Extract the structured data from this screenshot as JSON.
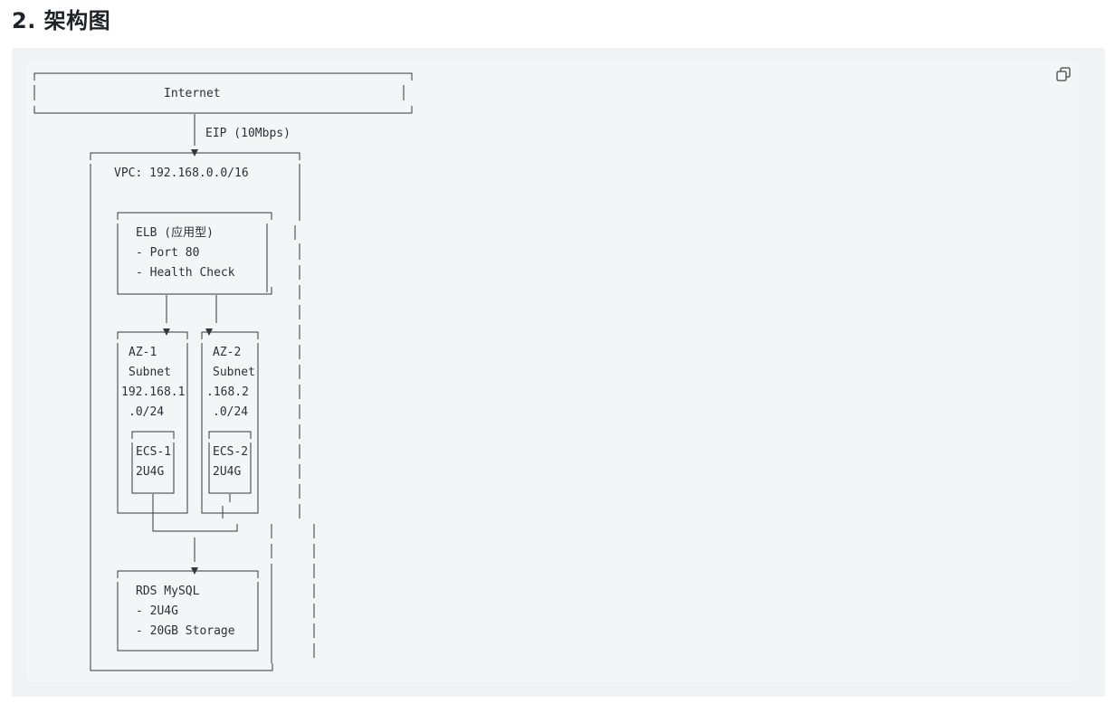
{
  "section": {
    "heading": "2. 架构图"
  },
  "code_block": {
    "copy_icon": "copy-icon",
    "diagram": {
      "internet": "Internet",
      "eip": "EIP (10Mbps)",
      "vpc": "VPC: 192.168.0.0/16",
      "elb_title": "ELB (应用型)",
      "elb_port": "- Port 80",
      "elb_health": "- Health Check",
      "az1_name": "AZ-1",
      "az1_subnet": "Subnet",
      "az1_cidr_1": "192.168.1",
      "az1_cidr_2": ".0/24",
      "az2_name": "AZ-2",
      "az2_subnet": "Subnet",
      "az2_cidr_1": ".168.2",
      "az2_cidr_2": ".0/24",
      "ecs1_name": "ECS-1",
      "ecs1_spec": "2U4G",
      "ecs2_name": "ECS-2",
      "ecs2_spec": "2U4G",
      "rds_title": "RDS MySQL",
      "rds_spec": "- 2U4G",
      "rds_storage": "- 20GB Storage"
    }
  }
}
